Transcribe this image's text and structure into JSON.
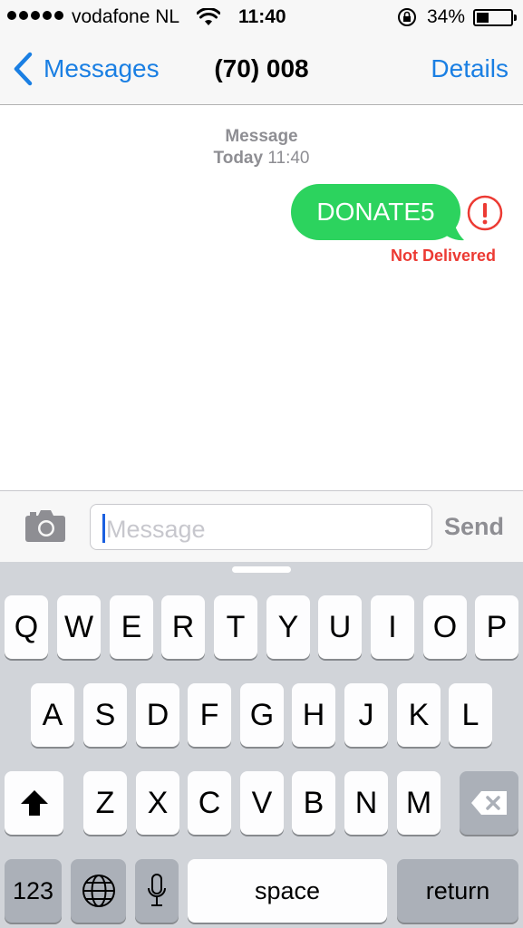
{
  "status_bar": {
    "carrier": "vodafone NL",
    "time": "11:40",
    "battery_percent": "34%",
    "battery_level": 0.34,
    "signal_bars": 5
  },
  "nav": {
    "back_label": "Messages",
    "title": "(70) 008",
    "details_label": "Details"
  },
  "conversation": {
    "timestamp_label": "Message",
    "timestamp_day": "Today",
    "timestamp_time": "11:40",
    "message_text": "DONATE5",
    "delivery_status": "Not Delivered"
  },
  "input": {
    "placeholder": "Message",
    "send_label": "Send"
  },
  "keyboard": {
    "row1": [
      "Q",
      "W",
      "E",
      "R",
      "T",
      "Y",
      "U",
      "I",
      "O",
      "P"
    ],
    "row2": [
      "A",
      "S",
      "D",
      "F",
      "G",
      "H",
      "J",
      "K",
      "L"
    ],
    "row3": [
      "Z",
      "X",
      "C",
      "V",
      "B",
      "N",
      "M"
    ],
    "numbers_label": "123",
    "space_label": "space",
    "return_label": "return"
  },
  "colors": {
    "accent": "#1a7fe3",
    "bubble": "#2cd35e",
    "error": "#ec3a33",
    "keyboard_bg": "#d1d4d9"
  }
}
